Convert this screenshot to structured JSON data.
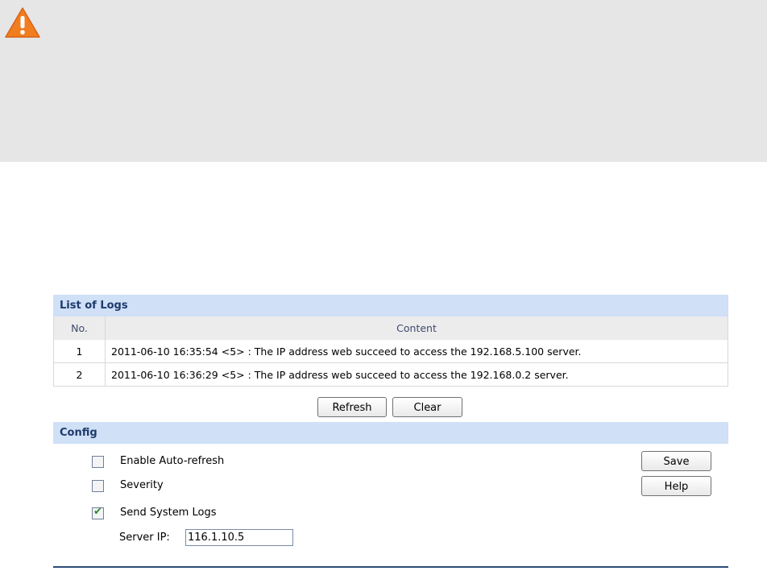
{
  "warning": {
    "icon": "warning-triangle-icon"
  },
  "logs": {
    "title": "List of Logs",
    "columns": [
      "No.",
      "Content"
    ],
    "rows": [
      {
        "no": "1",
        "content": "2011-06-10 16:35:54 <5> : The IP address web succeed to access the 192.168.5.100 server."
      },
      {
        "no": "2",
        "content": "2011-06-10 16:36:29 <5> : The IP address web succeed to access the 192.168.0.2 server."
      }
    ],
    "refresh_label": "Refresh",
    "clear_label": "Clear"
  },
  "config": {
    "title": "Config",
    "auto_refresh_label": "Enable Auto-refresh",
    "auto_refresh_checked": false,
    "severity_label": "Severity",
    "severity_checked": false,
    "send_logs_label": "Send System Logs",
    "send_logs_checked": true,
    "server_ip_label": "Server IP:",
    "server_ip_value": "116.1.10.5",
    "save_label": "Save",
    "help_label": "Help"
  },
  "colors": {
    "header_bg": "#cfe0f7",
    "header_text": "#1f3a6b",
    "warn_orange": "#f07d1e",
    "panel_gray": "#e6e6e6"
  }
}
